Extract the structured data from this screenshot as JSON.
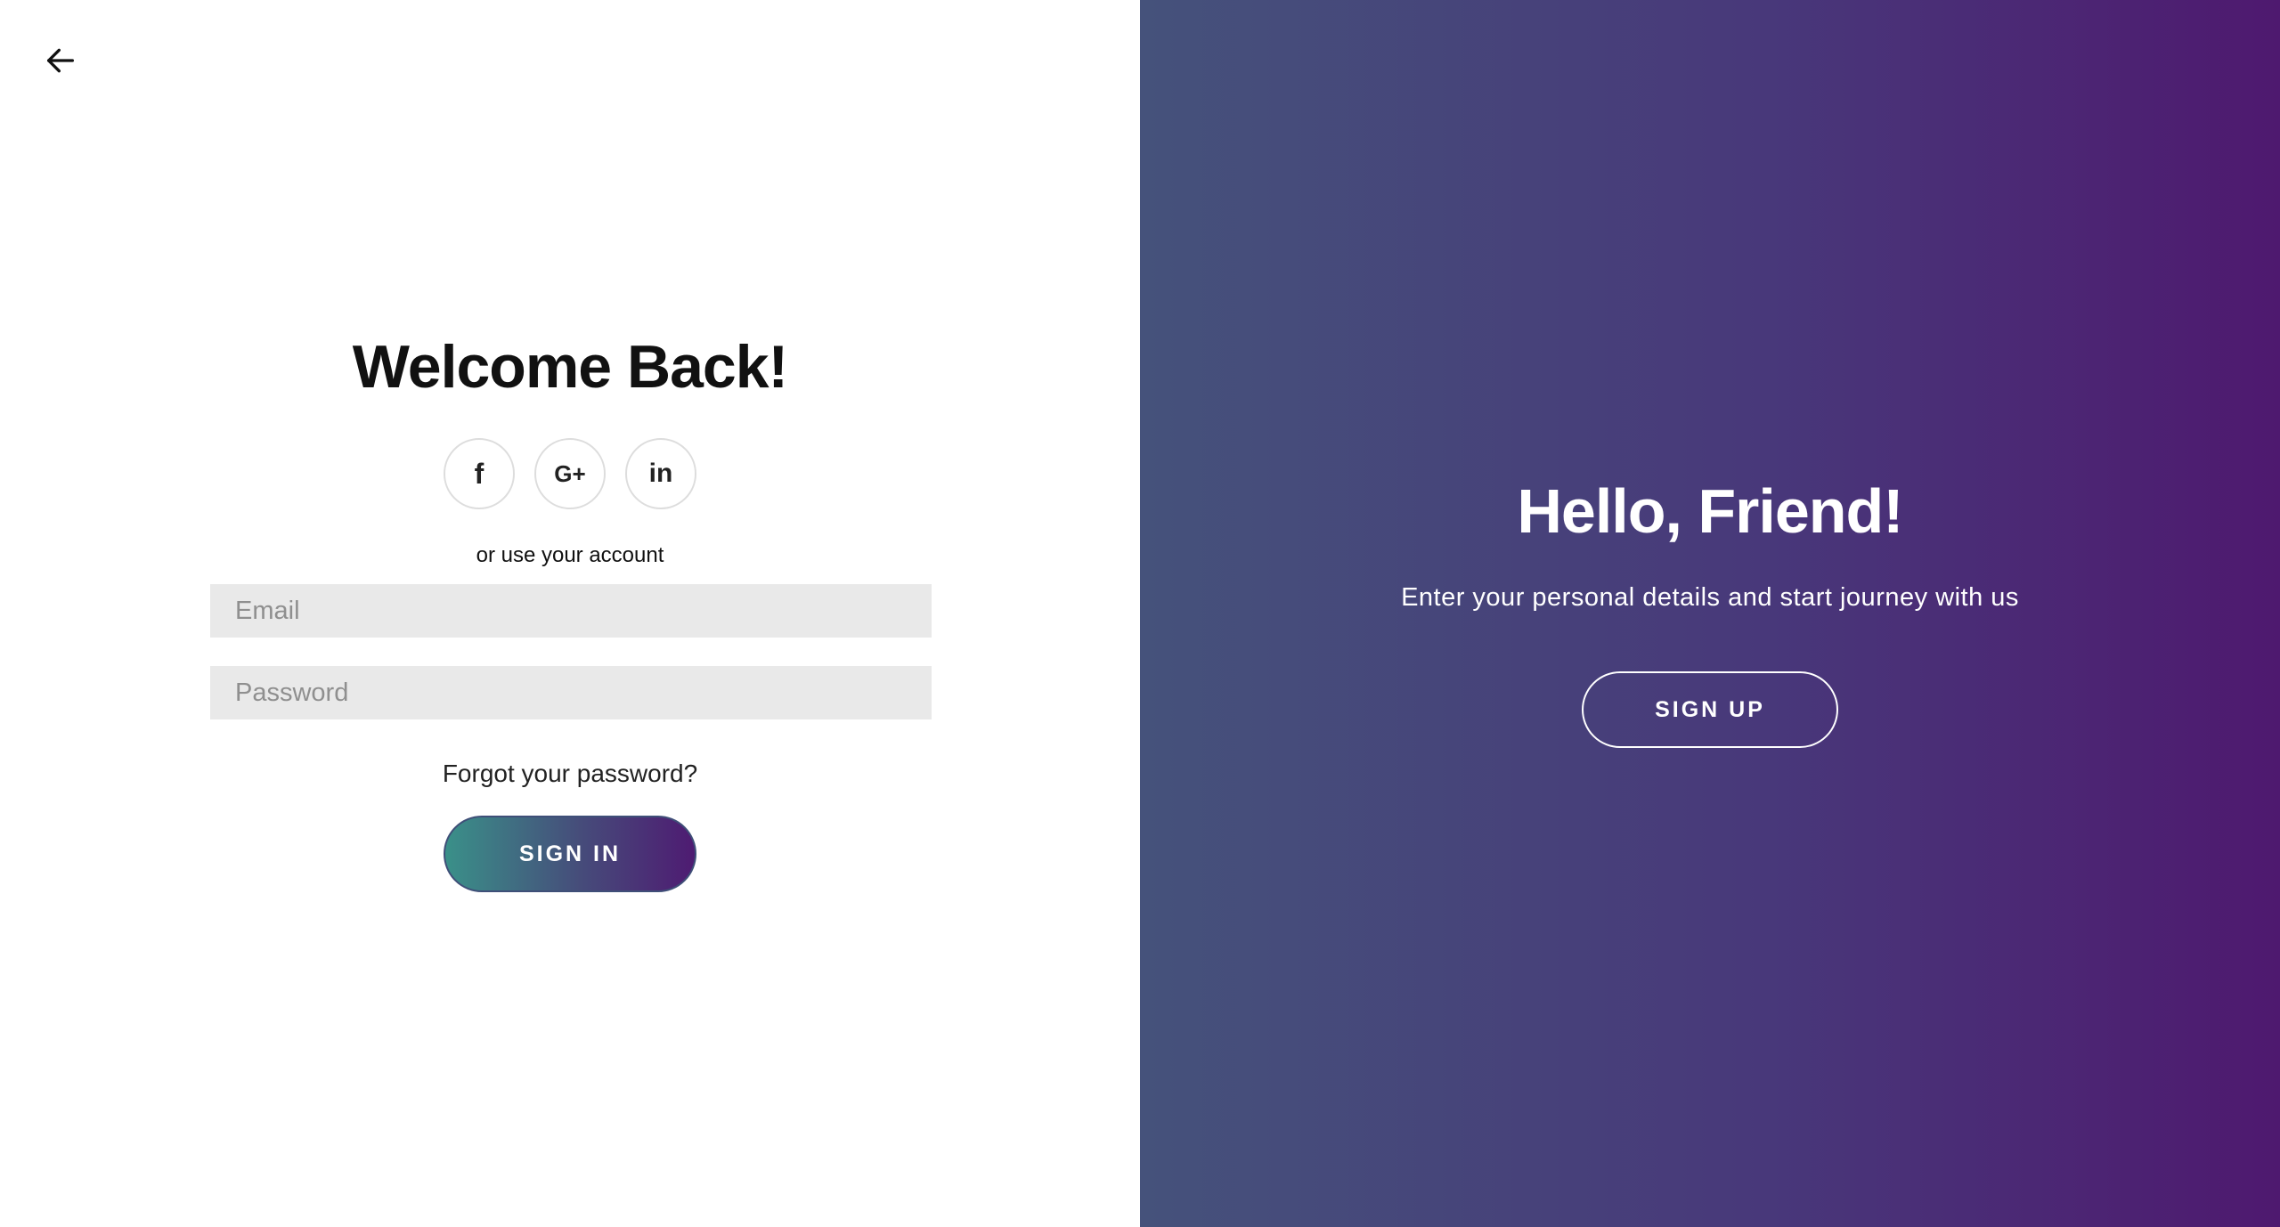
{
  "sign_in": {
    "back_icon": "arrow-left-icon",
    "title": "Welcome Back!",
    "social": [
      {
        "name": "facebook",
        "glyph": "f",
        "icon": "facebook-icon"
      },
      {
        "name": "google-plus",
        "glyph": "G+",
        "icon": "google-plus-icon"
      },
      {
        "name": "linkedin",
        "glyph": "in",
        "icon": "linkedin-icon"
      }
    ],
    "alt_text": "or use your account",
    "email_placeholder": "Email",
    "email_value": "",
    "password_placeholder": "Password",
    "password_value": "",
    "forgot_label": "Forgot your password?",
    "submit_label": "SIGN IN"
  },
  "sign_up": {
    "title": "Hello, Friend!",
    "subtitle": "Enter your personal details and start journey with us",
    "button_label": "SIGN UP"
  },
  "colors": {
    "panel_gradient_start": "#45527b",
    "panel_gradient_end": "#4e196f",
    "signin_gradient_start": "#3a9089",
    "signin_gradient_end": "#4e1b72",
    "input_bg": "#e9e9e9"
  }
}
